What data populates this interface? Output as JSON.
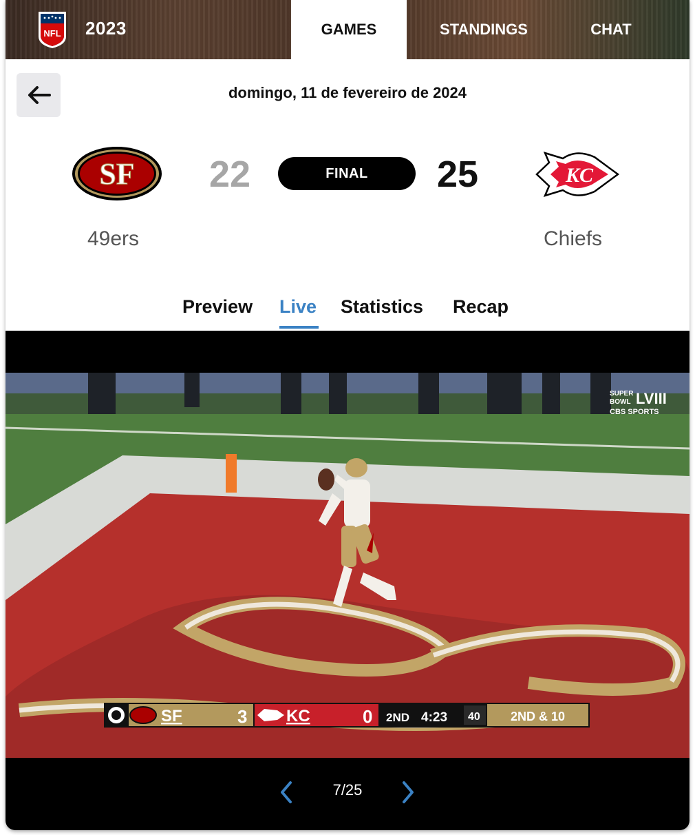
{
  "header": {
    "season": "2023",
    "tabs": [
      {
        "label": "GAMES",
        "active": true
      },
      {
        "label": "STANDINGS",
        "active": false
      },
      {
        "label": "CHAT",
        "active": false
      }
    ],
    "logo_text": "NFL"
  },
  "game": {
    "date": "domingo, 11 de fevereiro de 2024",
    "status": "FINAL",
    "away": {
      "name": "49ers",
      "score": "22",
      "logo_text": "SF"
    },
    "home": {
      "name": "Chiefs",
      "score": "25",
      "logo_text": "KC"
    }
  },
  "subtabs": [
    {
      "label": "Preview",
      "active": false
    },
    {
      "label": "Live",
      "active": true
    },
    {
      "label": "Statistics",
      "active": false
    },
    {
      "label": "Recap",
      "active": false
    }
  ],
  "video": {
    "broadcast_logo": {
      "line1": "SUPER",
      "line2": "BOWL",
      "numeral": "LVIII",
      "network": "CBS SPORTS"
    },
    "scorebug": {
      "away_abbr": "SF",
      "away_score": "3",
      "home_abbr": "KC",
      "home_score": "0",
      "quarter": "2ND",
      "clock": "4:23",
      "play_clock": "40",
      "down_distance": "2ND & 10"
    }
  },
  "pager": {
    "current": "7/25"
  },
  "colors": {
    "accent": "#3b82c4",
    "niners_red": "#aa0000",
    "niners_gold": "#b3995d",
    "chiefs_red": "#e31837"
  }
}
